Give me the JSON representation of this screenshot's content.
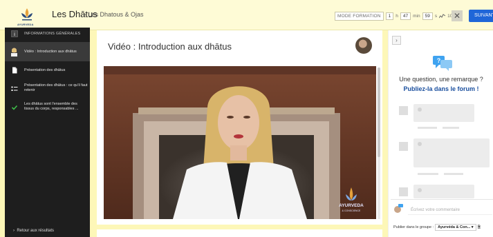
{
  "header": {
    "logo_text": "AYURVEDA",
    "title": "Les Dhātus",
    "subtitle": "- Les Dhatous & Ojas",
    "mode_label": "MODE FORMATION",
    "timer": {
      "hours": "1",
      "h_unit": "h",
      "minutes": "47",
      "min_unit": "min",
      "seconds": "59",
      "s_unit": "s",
      "speed": "100 %"
    },
    "close_label": "✕",
    "next_label": "SUIVANT"
  },
  "sidebar": {
    "items": [
      {
        "label": "INFORMATIONS GÉNÉRALES",
        "icon": "info-icon"
      },
      {
        "label": "Vidéo : Introduction aux dhātus",
        "icon": "video-avatar-icon"
      },
      {
        "label": "Présentation des dhātus",
        "icon": "document-icon"
      },
      {
        "label": "Présentation des dhātus : ce qu'il faut retenir",
        "icon": "list-icon"
      },
      {
        "label": "Les dhātus sont l'ensemble des tissus du corps, responsables ...",
        "icon": "check-icon"
      }
    ],
    "back_label": "Retour aux résultats"
  },
  "main": {
    "title": "Vidéo : Introduction aux dhātus",
    "watermark_brand": "AYURVEDA",
    "watermark_sub": "& CONSCIENCE"
  },
  "forum": {
    "question": "Une question, une remarque ?",
    "link": "Publiez-la dans le forum !",
    "comment_placeholder": "Écrivez votre commentaire",
    "publish_label": "Publier dans le groupe :",
    "group_value": "Ayurvéda & Con..."
  },
  "colors": {
    "accent": "#1f66d8",
    "sidebar_bg": "#1e1e1e",
    "header_bg": "#fefbd6",
    "link": "#1a4f9e",
    "check": "#3fc04a"
  }
}
